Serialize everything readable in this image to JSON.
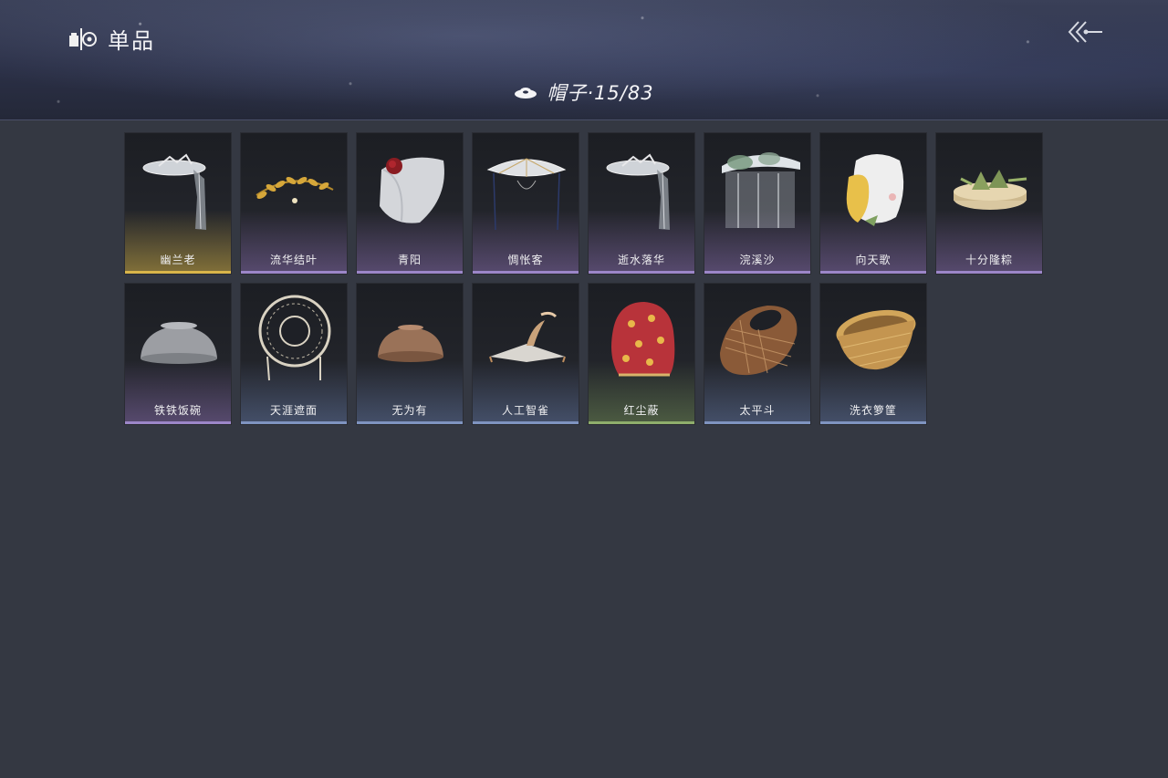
{
  "header": {
    "title": "单品",
    "category_label": "帽子·15/83",
    "back_icon": "back-arrow-icon"
  },
  "items": [
    {
      "name": "幽兰老",
      "rarity": "gold",
      "icon": "silver-veiled-hat"
    },
    {
      "name": "流华结叶",
      "rarity": "purple",
      "icon": "golden-leaf-circlet"
    },
    {
      "name": "青阳",
      "rarity": "purple",
      "icon": "white-hood-red-flower"
    },
    {
      "name": "惆怅客",
      "rarity": "purple",
      "icon": "white-bamboo-hat"
    },
    {
      "name": "逝水落华",
      "rarity": "purple",
      "icon": "silver-veiled-hat"
    },
    {
      "name": "浣溪沙",
      "rarity": "purple",
      "icon": "lotus-veil-hat"
    },
    {
      "name": "向天歌",
      "rarity": "purple",
      "icon": "goose-hood"
    },
    {
      "name": "十分隆粽",
      "rarity": "purple",
      "icon": "zongzi-steamer"
    },
    {
      "name": "铁铁饭碗",
      "rarity": "purple",
      "icon": "iron-bowl"
    },
    {
      "name": "天涯遮面",
      "rarity": "blue",
      "icon": "woven-frame-hat"
    },
    {
      "name": "无为有",
      "rarity": "blue",
      "icon": "clay-bowl-hat"
    },
    {
      "name": "人工智雀",
      "rarity": "blue",
      "icon": "bird-flat-hat"
    },
    {
      "name": "红尘蔽",
      "rarity": "green",
      "icon": "red-cloth-hood"
    },
    {
      "name": "太平斗",
      "rarity": "blue",
      "icon": "wicker-basket-hat"
    },
    {
      "name": "洗衣箩筐",
      "rarity": "blue",
      "icon": "wicker-basket"
    }
  ]
}
